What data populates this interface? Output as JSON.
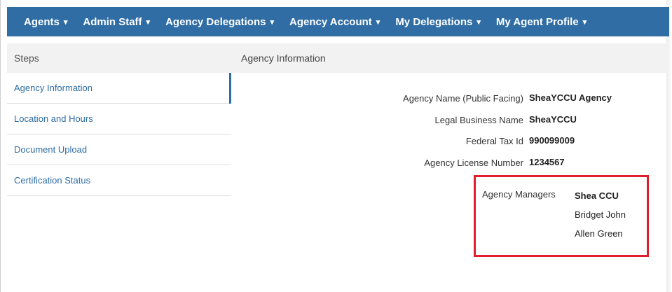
{
  "nav": {
    "items": [
      {
        "label": "Agents",
        "caret": "▾"
      },
      {
        "label": "Admin Staff",
        "caret": "▾"
      },
      {
        "label": "Agency Delegations",
        "caret": "▾"
      },
      {
        "label": "Agency Account",
        "caret": "▾"
      },
      {
        "label": "My Delegations",
        "caret": "▾"
      },
      {
        "label": "My Agent Profile",
        "caret": "▾"
      }
    ]
  },
  "steps": {
    "header": "Steps",
    "items": [
      {
        "label": "Agency Information"
      },
      {
        "label": "Location and Hours"
      },
      {
        "label": "Document Upload"
      },
      {
        "label": "Certification Status"
      }
    ]
  },
  "main": {
    "header": "Agency Information",
    "fields": {
      "agency_name_label": "Agency Name (Public Facing)",
      "agency_name_value": "SheaYCCU Agency",
      "legal_name_label": "Legal Business Name",
      "legal_name_value": "SheaYCCU",
      "tax_id_label": "Federal Tax Id",
      "tax_id_value": "990099009",
      "license_label": "Agency License Number",
      "license_value": "1234567",
      "managers_label": "Agency Managers",
      "managers": [
        "Shea CCU",
        "Bridget John",
        "Allen Green"
      ]
    }
  },
  "colors": {
    "nav_bg": "#2f6da4",
    "highlight": "#e01e2d"
  }
}
